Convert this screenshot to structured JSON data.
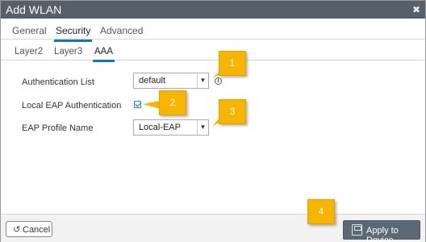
{
  "dialog": {
    "title": "Add WLAN",
    "close_glyph": "✖"
  },
  "main_tabs": [
    {
      "label": "General",
      "active": false
    },
    {
      "label": "Security",
      "active": true
    },
    {
      "label": "Advanced",
      "active": false
    }
  ],
  "sub_tabs": [
    {
      "label": "Layer2",
      "active": false
    },
    {
      "label": "Layer3",
      "active": false
    },
    {
      "label": "AAA",
      "active": true
    }
  ],
  "form": {
    "authentication_list": {
      "label": "Authentication List",
      "value": "default"
    },
    "local_eap_authentication": {
      "label": "Local EAP Authentication",
      "checked": true
    },
    "eap_profile_name": {
      "label": "EAP Profile Name",
      "value": "Local-EAP"
    }
  },
  "callouts": [
    "1",
    "2",
    "3",
    "4"
  ],
  "footer": {
    "cancel_label": "Cancel",
    "apply_label": "Apply to Device"
  },
  "colors": {
    "titlebar": "#56606b",
    "active_tab_underline": "#0d79c4",
    "callout": "#f7b500",
    "apply_button": "#5b6975"
  }
}
